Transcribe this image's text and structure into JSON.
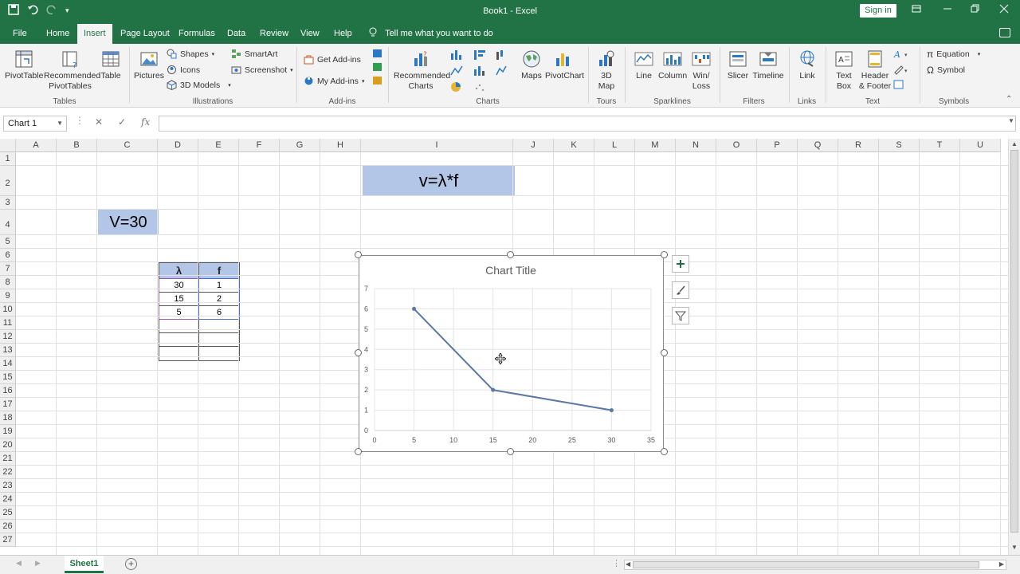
{
  "window": {
    "title": "Book1 - Excel",
    "signin_label": "Sign in"
  },
  "tabs": [
    "File",
    "Home",
    "Insert",
    "Page Layout",
    "Formulas",
    "Data",
    "Review",
    "View",
    "Help"
  ],
  "active_tab": "Insert",
  "tell_me": "Tell me what you want to do",
  "ribbon": {
    "tables": {
      "label": "Tables",
      "pivot": "PivotTable",
      "recommended_1": "Recommended",
      "recommended_2": "PivotTables",
      "table": "Table"
    },
    "illustrations": {
      "label": "Illustrations",
      "pictures": "Pictures",
      "shapes": "Shapes",
      "icons": "Icons",
      "models": "3D Models",
      "smartart": "SmartArt",
      "screenshot": "Screenshot"
    },
    "addins": {
      "label": "Add-ins",
      "get": "Get Add-ins",
      "my": "My Add-ins"
    },
    "charts": {
      "label": "Charts",
      "recommended_1": "Recommended",
      "recommended_2": "Charts",
      "maps": "Maps",
      "pivotchart": "PivotChart"
    },
    "tours": {
      "label": "Tours",
      "map_1": "3D",
      "map_2": "Map"
    },
    "sparklines": {
      "label": "Sparklines",
      "line": "Line",
      "column": "Column",
      "winloss_1": "Win/",
      "winloss_2": "Loss"
    },
    "filters": {
      "label": "Filters",
      "slicer": "Slicer",
      "timeline": "Timeline"
    },
    "links": {
      "label": "Links",
      "link": "Link"
    },
    "text": {
      "label": "Text",
      "textbox_1": "Text",
      "textbox_2": "Box",
      "header_1": "Header",
      "header_2": "& Footer"
    },
    "symbols": {
      "label": "Symbols",
      "equation": "Equation",
      "symbol": "Symbol"
    }
  },
  "namebox": "Chart 1",
  "columns": [
    "A",
    "B",
    "C",
    "D",
    "E",
    "F",
    "G",
    "H",
    "I",
    "J",
    "K",
    "L",
    "M",
    "N",
    "O",
    "P",
    "Q",
    "R",
    "S",
    "T",
    "U"
  ],
  "rows": [
    "1",
    "2",
    "3",
    "4",
    "5",
    "6",
    "7",
    "8",
    "9",
    "10",
    "11",
    "12",
    "13",
    "14",
    "15",
    "16",
    "17",
    "18",
    "19",
    "20",
    "21",
    "22",
    "23",
    "24",
    "25",
    "26",
    "27"
  ],
  "cells": {
    "v30": "V=30",
    "formula": "v=λ*f",
    "table_headers": [
      "λ",
      "f"
    ],
    "table_rows": [
      [
        "30",
        "1"
      ],
      [
        "15",
        "2"
      ],
      [
        "5",
        "6"
      ]
    ]
  },
  "chart_data": {
    "type": "line",
    "title": "Chart Title",
    "x": [
      5,
      15,
      30
    ],
    "y": [
      6,
      2,
      1
    ],
    "xlim": [
      0,
      35
    ],
    "ylim": [
      0,
      7
    ],
    "x_ticks": [
      0,
      5,
      10,
      15,
      20,
      25,
      30,
      35
    ],
    "y_ticks": [
      0,
      1,
      2,
      3,
      4,
      5,
      6,
      7
    ],
    "grid": true,
    "line_color": "#5b76a8"
  },
  "sheet_tab": "Sheet1",
  "colors": {
    "excel_green": "#217346",
    "cell_fill": "#b4c6e7"
  }
}
